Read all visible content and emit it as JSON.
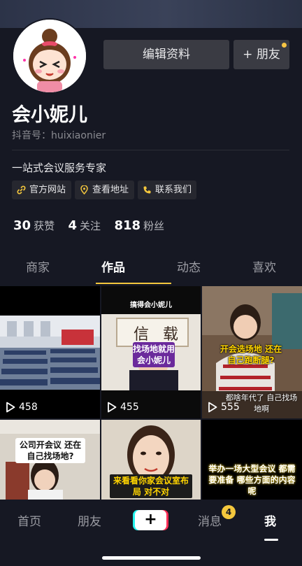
{
  "profile": {
    "name": "会小妮儿",
    "douyin_id": "抖音号：huixiaonier",
    "bio": "一站式会议服务专家",
    "edit_label": "编辑资料",
    "add_friend_label": "+ 朋友"
  },
  "links": [
    {
      "label": "官方网站",
      "icon": "link-icon"
    },
    {
      "label": "查看地址",
      "icon": "location-pin-icon"
    },
    {
      "label": "联系我们",
      "icon": "phone-icon"
    }
  ],
  "stats": {
    "likes_count": "30",
    "likes_label": "获赞",
    "following_count": "4",
    "following_label": "关注",
    "followers_count": "818",
    "followers_label": "粉丝"
  },
  "tabs": [
    {
      "label": "商家"
    },
    {
      "label": "作品"
    },
    {
      "label": "动态"
    },
    {
      "label": "喜欢"
    }
  ],
  "active_tab": "作品",
  "videos": [
    {
      "plays": "458"
    },
    {
      "plays": "455",
      "header": "找场地就用会小妮儿",
      "subtitle": "搞得会小妮儿"
    },
    {
      "plays": "555",
      "caption": "开会选场地 还在自己跑断腿?",
      "overlay": "都啥年代了 自己找场地啊"
    },
    {
      "caption": "公司开会议 还在自己找场地?"
    },
    {
      "caption": "来看看你家会议室布局 对不对"
    },
    {
      "caption": "举办一场大型会议 都需要准备 哪些方面的内容呢"
    }
  ],
  "nav": {
    "home": "首页",
    "friends": "朋友",
    "plus": "+",
    "messages": "消息",
    "messages_badge": "4",
    "me": "我"
  },
  "colors": {
    "background": "#161823",
    "accent": "#f4c73d",
    "button": "#3a3b43"
  }
}
